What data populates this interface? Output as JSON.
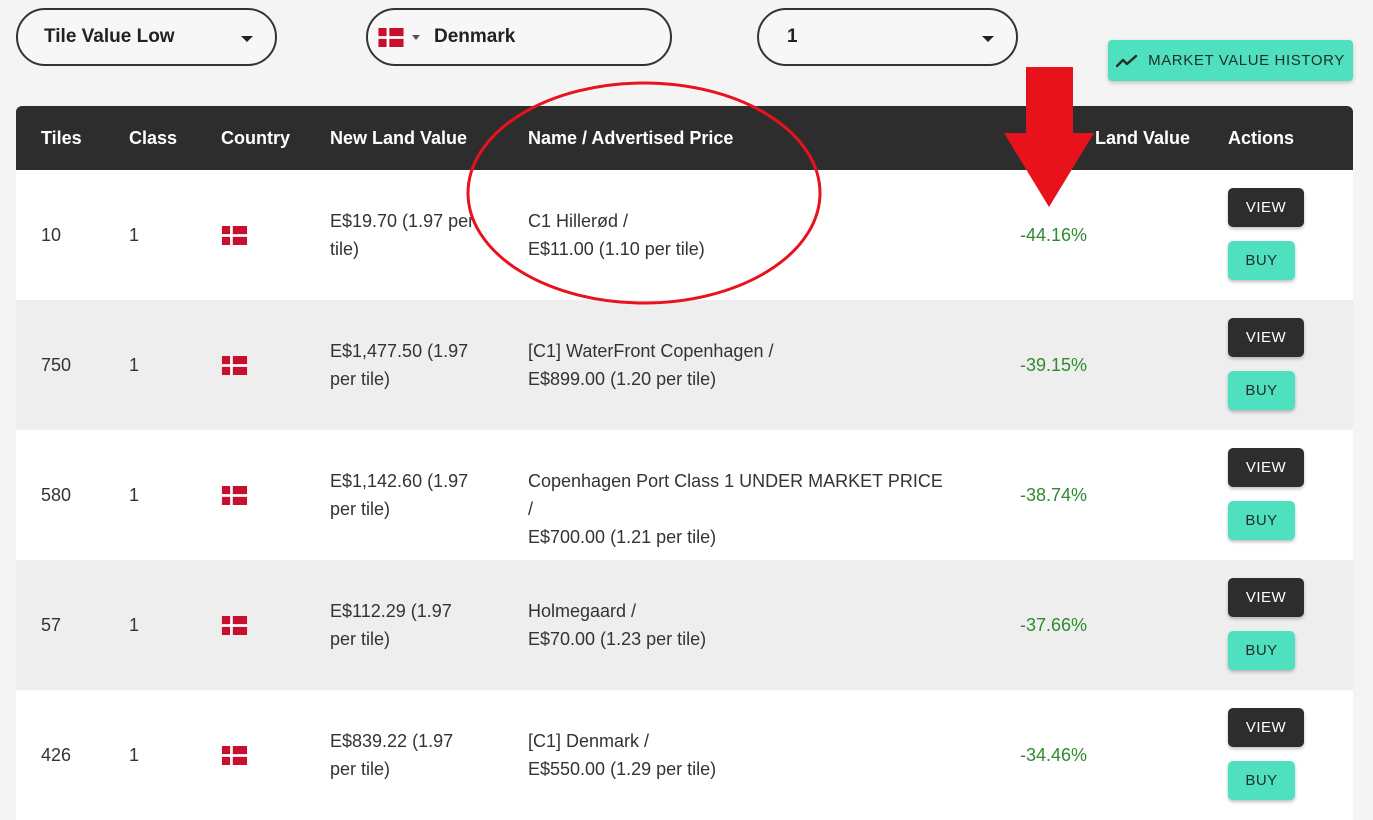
{
  "filters": {
    "sort_value": "Tile Value Low",
    "country_value": "Denmark",
    "class_value": "1"
  },
  "market_value_history_label": "MARKET VALUE HISTORY",
  "table": {
    "headers": {
      "tiles": "Tiles",
      "class": "Class",
      "country": "Country",
      "new_land_value": "New Land Value",
      "name_price": "Name / Advertised Price",
      "diff_partial": "Land Value",
      "actions": "Actions"
    },
    "rows": [
      {
        "tiles": "10",
        "class": "1",
        "country": "Denmark",
        "nlv": "E$19.70 (1.97 per tile)",
        "name": "C1 Hillerød /",
        "price": "E$11.00 (1.10 per tile)",
        "pct": "-44.16%"
      },
      {
        "tiles": "750",
        "class": "1",
        "country": "Denmark",
        "nlv": "E$1,477.50 (1.97 per tile)",
        "name": "[C1] WaterFront Copenhagen /",
        "price": "E$899.00 (1.20 per tile)",
        "pct": "-39.15%"
      },
      {
        "tiles": "580",
        "class": "1",
        "country": "Denmark",
        "nlv": "E$1,142.60 (1.97 per tile)",
        "name": "Copenhagen Port Class 1 UNDER MARKET PRICE /",
        "price": "E$700.00 (1.21 per tile)",
        "pct": "-38.74%"
      },
      {
        "tiles": "57",
        "class": "1",
        "country": "Denmark",
        "nlv": "E$112.29 (1.97 per tile)",
        "name": "Holmegaard /",
        "price": "E$70.00 (1.23 per tile)",
        "pct": "-37.66%"
      },
      {
        "tiles": "426",
        "class": "1",
        "country": "Denmark",
        "nlv": "E$839.22 (1.97 per tile)",
        "name": "[C1] Denmark /",
        "price": "E$550.00 (1.29 per tile)",
        "pct": "-34.46%"
      }
    ],
    "view_label": "VIEW",
    "buy_label": "BUY"
  },
  "colors": {
    "accent": "#4fe0bf",
    "header_bg": "#2d2d2d",
    "positive_text": "#2e8b2e",
    "annotation_red": "#e8121d"
  },
  "icons": {
    "dropdown": "chevron-down-icon",
    "chart": "trending-line-icon",
    "flag": "denmark-flag-icon"
  }
}
